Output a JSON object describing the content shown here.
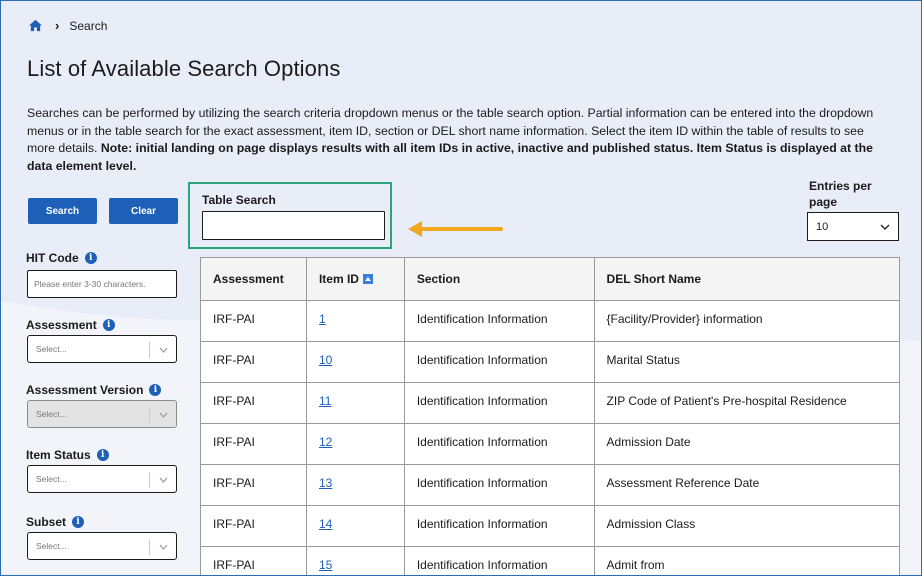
{
  "breadcrumb": {
    "home_icon": "home-icon",
    "current": "Search"
  },
  "page": {
    "title": "List of Available Search Options",
    "description_plain": "Searches can be performed by utilizing the search criteria dropdown menus or the table search option. Partial information can be entered into the dropdown menus or in the table search for the exact assessment, item ID, section or DEL short name information. Select the item ID within the table of results to see more details. ",
    "description_bold": "Note: initial landing on page displays results with all item IDs in active, inactive and published status. Item Status is displayed at the data element level."
  },
  "buttons": {
    "search": "Search",
    "clear": "Clear"
  },
  "table_search": {
    "label": "Table Search",
    "value": ""
  },
  "entries": {
    "label": "Entries per page",
    "value": "10"
  },
  "filters": {
    "hit_code": {
      "label": "HIT Code",
      "placeholder": "Please enter 3-30 characters."
    },
    "assessment": {
      "label": "Assessment",
      "placeholder": "Select..."
    },
    "assessment_version": {
      "label": "Assessment Version",
      "placeholder": "Select..."
    },
    "item_status": {
      "label": "Item Status",
      "placeholder": "Select..."
    },
    "subset": {
      "label": "Subset",
      "placeholder": "Select..."
    }
  },
  "table": {
    "headers": [
      "Assessment",
      "Item ID",
      "Section",
      "DEL Short Name"
    ],
    "rows": [
      [
        "IRF-PAI",
        "1",
        "Identification Information",
        "{Facility/Provider} information"
      ],
      [
        "IRF-PAI",
        "10",
        "Identification Information",
        "Marital Status"
      ],
      [
        "IRF-PAI",
        "11",
        "Identification Information",
        "ZIP Code of Patient's Pre-hospital Residence"
      ],
      [
        "IRF-PAI",
        "12",
        "Identification Information",
        "Admission Date"
      ],
      [
        "IRF-PAI",
        "13",
        "Identification Information",
        "Assessment Reference Date"
      ],
      [
        "IRF-PAI",
        "14",
        "Identification Information",
        "Admission Class"
      ],
      [
        "IRF-PAI",
        "15",
        "Identification Information",
        "Admit from"
      ]
    ]
  },
  "colors": {
    "primary": "#1e5fb8",
    "highlight_box": "#2aa57a",
    "arrow": "#f0a81e"
  }
}
